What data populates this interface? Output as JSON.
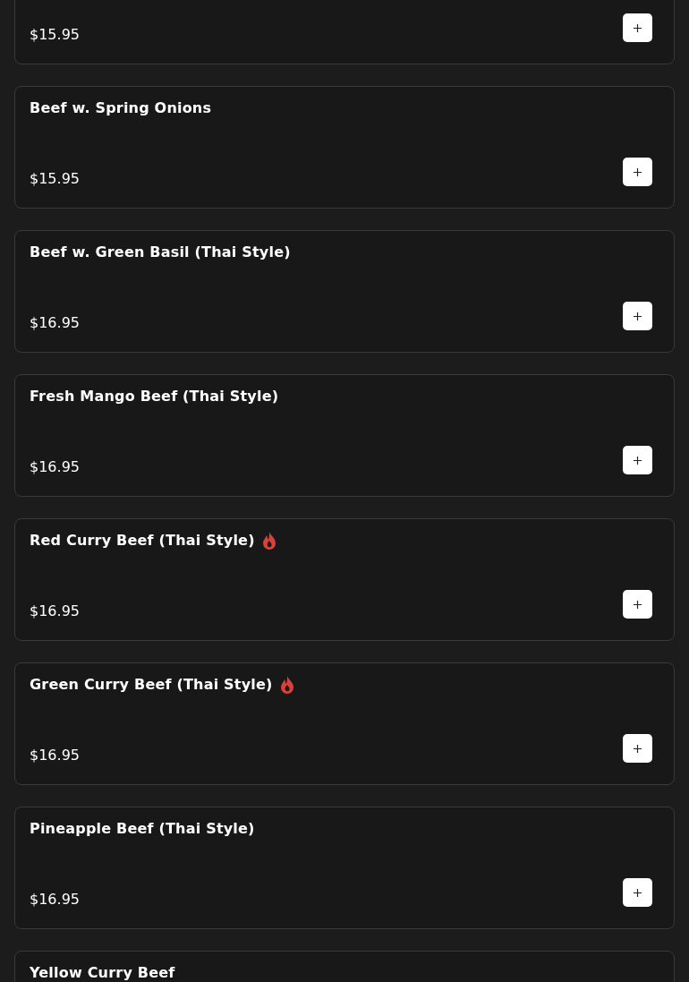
{
  "items": [
    {
      "price": "$15.95"
    },
    {
      "name": "Beef w. Spring Onions",
      "price": "$15.95",
      "spicy": false
    },
    {
      "name": "Beef w. Green Basil (Thai Style)",
      "price": "$16.95",
      "spicy": false
    },
    {
      "name": "Fresh Mango Beef (Thai Style)",
      "price": "$16.95",
      "spicy": false
    },
    {
      "name": "Red Curry Beef (Thai Style)",
      "price": "$16.95",
      "spicy": true
    },
    {
      "name": "Green Curry Beef (Thai Style)",
      "price": "$16.95",
      "spicy": true
    },
    {
      "name": "Pineapple Beef (Thai Style)",
      "price": "$16.95",
      "spicy": false
    },
    {
      "name": "Yellow Curry Beef",
      "spicy": false
    }
  ]
}
